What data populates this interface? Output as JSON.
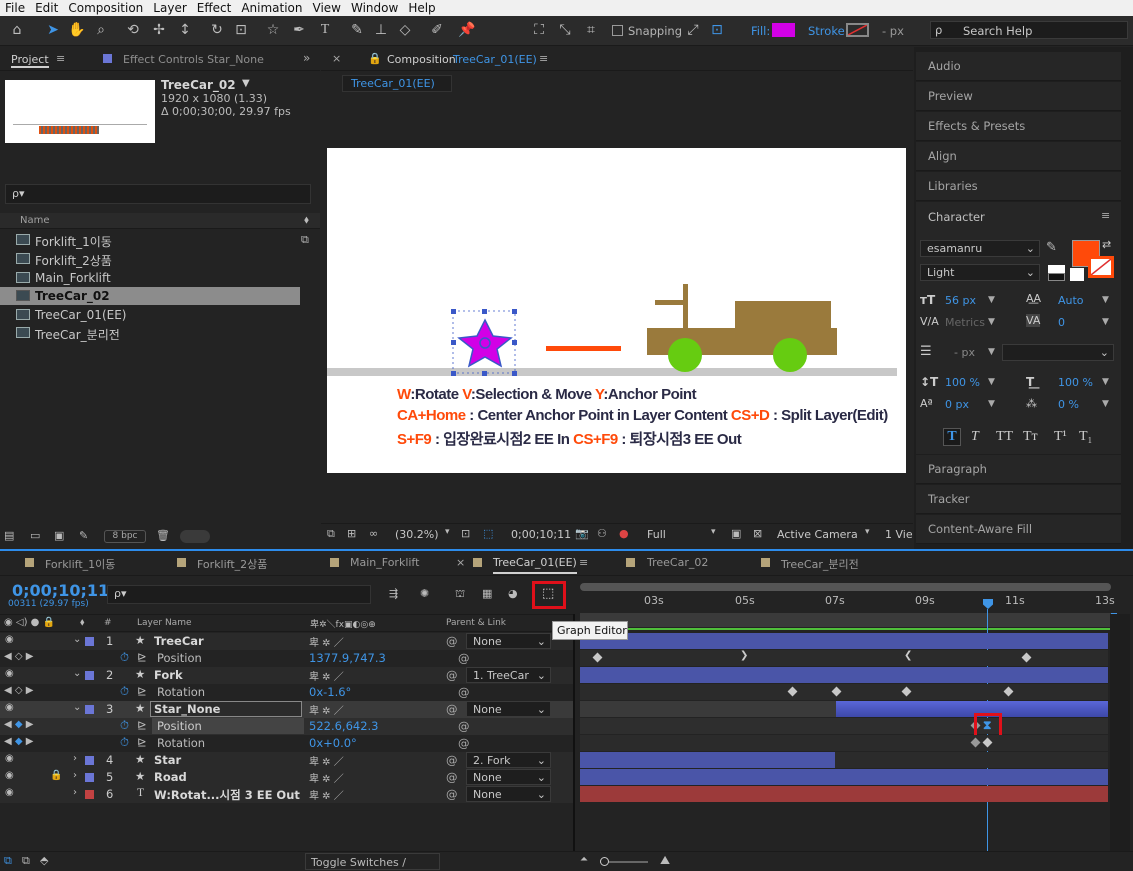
{
  "menu": [
    "File",
    "Edit",
    "Composition",
    "Layer",
    "Effect",
    "Animation",
    "View",
    "Window",
    "Help"
  ],
  "toolbar": {
    "snapping_label": "Snapping",
    "fill_label": "Fill:",
    "stroke_label": "Stroke:",
    "px_label": "- px",
    "search_placeholder": "Search Help",
    "fill_color": "#d200e6"
  },
  "project": {
    "tab_project": "Project",
    "tab_effect_controls": "Effect Controls Star_None",
    "comp_name": "TreeCar_02",
    "comp_size": "1920 x 1080 (1.33)",
    "comp_duration": "Δ 0;00;30;00, 29.97 fps",
    "search_icon_label": "ρ▾",
    "column_name": "Name",
    "items": [
      "Forklift_1이동",
      "Forklift_2상품",
      "Main_Forklift",
      "TreeCar_02",
      "TreeCar_01(EE)",
      "TreeCar_분리전"
    ],
    "bpc": "8 bpc"
  },
  "composition": {
    "tab_label": "Composition",
    "tab_comp": "TreeCar_01(EE)",
    "subtab": "TreeCar_01(EE)",
    "zoom": "(30.2%)",
    "timecode": "0;00;10;11",
    "resolution": "Full",
    "camera": "Active Camera",
    "view": "1 Vie",
    "text_line1_a": "W",
    "text_line1_b": ":Rotate  ",
    "text_line1_c": "V",
    "text_line1_d": ":Selection & Move  ",
    "text_line1_e": "Y",
    "text_line1_f": ":Anchor Point",
    "text_line2_a": "CA+Home",
    "text_line2_b": " : Center Anchor Point in Layer Content ",
    "text_line2_c": "CS+D",
    "text_line2_d": " : Split Layer(Edit)",
    "text_line3_a": "S+F9",
    "text_line3_b": " : 입장완료시점2 EE In  ",
    "text_line3_c": "CS+F9",
    "text_line3_d": " : 퇴장시점3 EE Out"
  },
  "right_panels": [
    "Audio",
    "Preview",
    "Effects & Presets",
    "Align",
    "Libraries"
  ],
  "character": {
    "title": "Character",
    "font": "esamanru",
    "style": "Light",
    "size": "56 px",
    "leading": "Auto",
    "kerning": "Metrics",
    "tracking": "0",
    "stroke_width": "- px",
    "vscale": "100 %",
    "hscale": "100 %",
    "baseline": "0 px",
    "tsume": "0 %",
    "color": "#ff4a0a"
  },
  "bottom_panels": [
    "Paragraph",
    "Tracker",
    "Content-Aware Fill"
  ],
  "timeline": {
    "tabs": [
      "Forklift_1이동",
      "Forklift_2상품",
      "Main_Forklift",
      "TreeCar_01(EE)",
      "TreeCar_02",
      "TreeCar_분리전"
    ],
    "timecode": "0;00;10;11",
    "frame_info": "00311 (29.97 fps)",
    "col_layer_name": "Layer Name",
    "col_parent": "Parent & Link",
    "ruler": [
      "03s",
      "05s",
      "07s",
      "09s",
      "11s",
      "13s"
    ],
    "tooltip": "Graph Editor",
    "footer": "Toggle Switches / Modes",
    "layers": [
      {
        "num": "1",
        "name": "TreeCar",
        "parent": "None",
        "color": "#6b76d6"
      },
      {
        "prop": "Position",
        "value": "1377.9,747.3"
      },
      {
        "num": "2",
        "name": "Fork",
        "parent": "1. TreeCar",
        "color": "#6b76d6"
      },
      {
        "prop": "Rotation",
        "value": "0x-1.6°"
      },
      {
        "num": "3",
        "name": "Star_None",
        "parent": "None",
        "color": "#6b76d6"
      },
      {
        "prop": "Position",
        "value": "522.6,642.3"
      },
      {
        "prop": "Rotation",
        "value": "0x+0.0°"
      },
      {
        "num": "4",
        "name": "Star",
        "parent": "2. Fork",
        "color": "#6b76d6"
      },
      {
        "num": "5",
        "name": "Road",
        "parent": "None",
        "color": "#6b76d6"
      },
      {
        "num": "6",
        "name": "W:Rotat...시점 3 EE Out",
        "parent": "None",
        "color": "#c24242"
      }
    ]
  }
}
